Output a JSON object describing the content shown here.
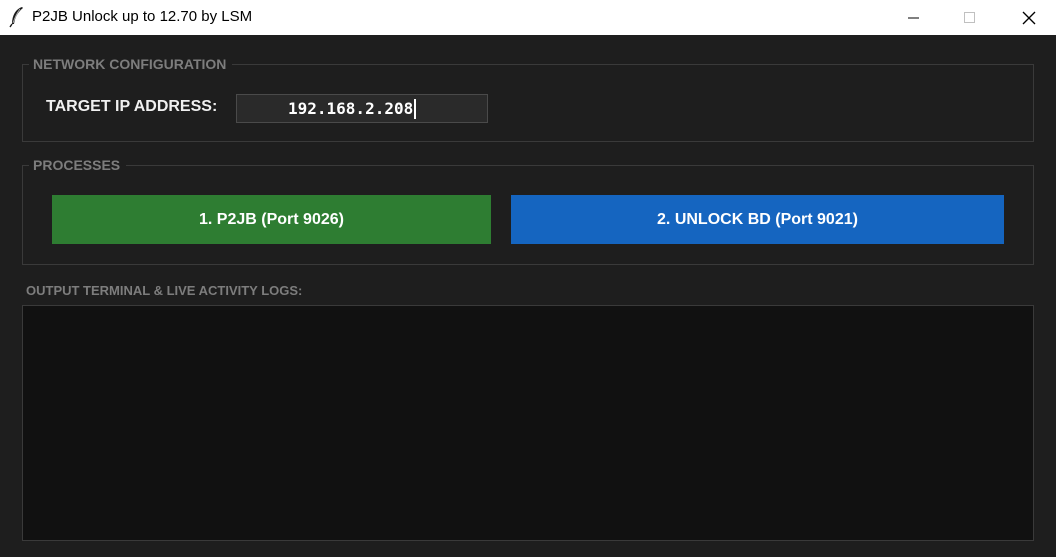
{
  "window": {
    "title": "P2JB Unlock up to 12.70 by LSM",
    "icon": "feather-icon"
  },
  "network": {
    "legend": "NETWORK CONFIGURATION",
    "ip_label": "TARGET IP ADDRESS:",
    "ip_value": "192.168.2.208"
  },
  "processes": {
    "legend": "PROCESSES",
    "p2jb_label": "1. P2JB (Port 9026)",
    "unlock_label": "2. UNLOCK BD (Port 9021)"
  },
  "log": {
    "label": "OUTPUT TERMINAL & LIVE ACTIVITY LOGS:",
    "content": ""
  },
  "colors": {
    "background": "#1e1e1e",
    "p2jb_button": "#2e7d32",
    "unlock_button": "#1565c0",
    "log_background": "#111111"
  }
}
